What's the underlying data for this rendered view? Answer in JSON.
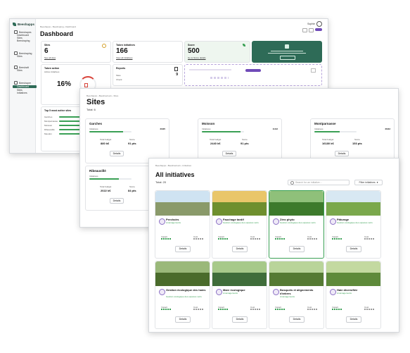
{
  "dashboard": {
    "app_name": "Beeshapps",
    "user": "Sophie",
    "breadcrumb": [
      "Beeshapps",
      "Beeshaping",
      "Dashboard"
    ],
    "title": "Dashboard",
    "nav": [
      {
        "label": "Beeshapes"
      },
      {
        "label": "Dashboard"
      },
      {
        "label": "Sites"
      },
      {
        "label": "Beeshaping"
      },
      {
        "label": "Beeshaping"
      },
      {
        "label": "Sites"
      },
      {
        "label": "Beeshaft"
      },
      {
        "label": "Sites"
      },
      {
        "label": "Beeshaper"
      },
      {
        "label": "Dashboard"
      },
      {
        "label": "Sites"
      },
      {
        "label": "Initiatives"
      }
    ],
    "sites_card": {
      "label": "Sites",
      "value": "6",
      "link": "See all sites"
    },
    "initiatives_card": {
      "label": "Taken initiatives",
      "value": "166",
      "link": "View all initiatives"
    },
    "score_card": {
      "label": "Score",
      "value": "500",
      "link": "Go to Score details"
    },
    "active_card": {
      "label": "Taken action",
      "sub": "Active initiatives",
      "value": "16%"
    },
    "reports_card": {
      "label": "Reports",
      "value": "9",
      "rows": [
        {
          "label": "Sites",
          "value": "9"
        },
        {
          "label": "Check",
          "value": ""
        }
      ]
    },
    "top_sites": {
      "title": "Top 5 most active sites",
      "rows": [
        "Garches",
        "Montparnasse",
        "Moisson",
        "Ribeauvillé",
        "Meudon"
      ]
    }
  },
  "sites": {
    "breadcrumb": [
      "Beeshapps",
      "Beeshaviours",
      "Sites"
    ],
    "title": "Sites",
    "total": "Total: 6",
    "cards": [
      {
        "name": "Garches",
        "init_label": "Initiatives",
        "init_value": "20/25",
        "progress": 0.8,
        "budget_label": "Total budget",
        "budget": "880 k€",
        "score_label": "Score",
        "score": "91 pts",
        "details": "Details"
      },
      {
        "name": "Moisson",
        "init_label": "Initiatives",
        "init_value": "11/12",
        "progress": 0.92,
        "budget_label": "Total budget",
        "budget": "2440 k€",
        "score_label": "Score",
        "score": "91 pts",
        "details": "Details"
      },
      {
        "name": "Montparnasse",
        "init_label": "Initiatives",
        "init_value": "26/43",
        "progress": 0.6,
        "budget_label": "Total budget",
        "budget": "16180 k€",
        "score_label": "Score",
        "score": "153 pts",
        "details": "Details"
      },
      {
        "name": "Ribeauvillé",
        "init_label": "Initiatives",
        "init_value": "",
        "progress": 0.7,
        "budget_label": "Total budget",
        "budget": "2022 k€",
        "score_label": "Score",
        "score": "84 pts",
        "details": "Details"
      }
    ]
  },
  "initiatives": {
    "breadcrumb": [
      "Beeshapps",
      "Beeshaviours",
      "Initiatives"
    ],
    "title": "All initiatives",
    "total": "Total: 20",
    "search_placeholder": "Search for an initiative...",
    "filter_label": "Filter initiatives",
    "cards": [
      {
        "name": "Perchoirs",
        "sub": "Aménagements",
        "impact_label": "Impact",
        "cost_label": "Cost",
        "details": "Details",
        "sky": "#cfe3f2",
        "ground": "#8a9a6a",
        "highlight": false
      },
      {
        "name": "Fauchage tardif",
        "sub": "Gestion écologique des espaces verts",
        "impact_label": "Impact",
        "cost_label": "Cost",
        "details": "Details",
        "sky": "#e9c66a",
        "ground": "#6e8f2e",
        "highlight": false
      },
      {
        "name": "Zéro phyto",
        "sub": "Gestion écologique des espaces verts",
        "impact_label": "Impact",
        "cost_label": "Cost",
        "details": "Details",
        "sky": "#8fc07a",
        "ground": "#3d7a2c",
        "highlight": true
      },
      {
        "name": "Pâturage",
        "sub": "Gestion écologique des espaces verts",
        "impact_label": "Impact",
        "cost_label": "Cost",
        "details": "Details",
        "sky": "#d8e8f3",
        "ground": "#7aa84c",
        "highlight": false
      },
      {
        "name": "Gestion écologique des haies",
        "sub": "Gestion écologique des espaces verts",
        "impact_label": "Impact",
        "cost_label": "Cost",
        "details": "Details",
        "sky": "#9ab87a",
        "ground": "#4a6b2b",
        "highlight": false
      },
      {
        "name": "Mare écologique",
        "sub": "Aménagements",
        "impact_label": "Impact",
        "cost_label": "Cost",
        "details": "Details",
        "sky": "#a7c98a",
        "ground": "#3f6d3a",
        "highlight": false
      },
      {
        "name": "Bosquets et alignements d'arbres",
        "sub": "Aménagements",
        "impact_label": "Impact",
        "cost_label": "Cost",
        "details": "Details",
        "sky": "#b9d49a",
        "ground": "#557a33",
        "highlight": false
      },
      {
        "name": "Haie diversifiée",
        "sub": "Aménagements",
        "impact_label": "Impact",
        "cost_label": "Cost",
        "details": "Details",
        "sky": "#c3d9a0",
        "ground": "#5e8a3a",
        "highlight": false
      }
    ]
  },
  "colors": {
    "accent": "#2e6b57",
    "purple": "#6f4bb8",
    "green": "#3aa055"
  }
}
